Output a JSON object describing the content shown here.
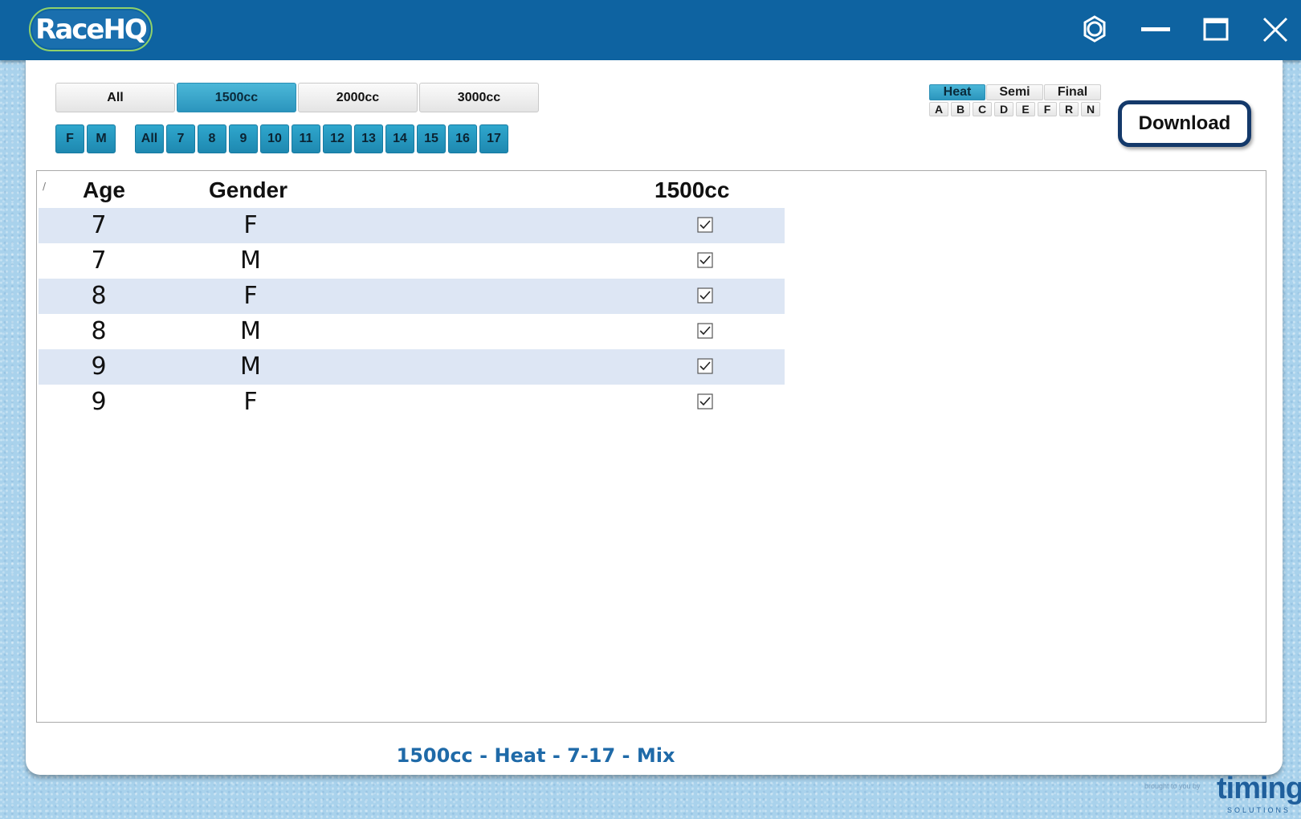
{
  "app": {
    "logo_text": "RaceHQ"
  },
  "window_controls": {
    "settings_icon": "gear-icon",
    "minimize_icon": "minimize-icon",
    "maximize_icon": "maximize-icon",
    "close_icon": "close-icon"
  },
  "class_tabs": [
    {
      "label": "All",
      "active": false
    },
    {
      "label": "1500cc",
      "active": true
    },
    {
      "label": "2000cc",
      "active": false
    },
    {
      "label": "3000cc",
      "active": false
    }
  ],
  "gender_filters": [
    "F",
    "M"
  ],
  "age_filters": [
    "All",
    "7",
    "8",
    "9",
    "10",
    "11",
    "12",
    "13",
    "14",
    "15",
    "16",
    "17"
  ],
  "round_tabs": [
    {
      "label": "Heat",
      "active": true
    },
    {
      "label": "Semi",
      "active": false
    },
    {
      "label": "Final",
      "active": false
    }
  ],
  "race_letters": [
    "A",
    "B",
    "C",
    "D",
    "E",
    "F",
    "R",
    "N"
  ],
  "download_label": "Download",
  "table": {
    "corner_mark": "/",
    "headers": {
      "age": "Age",
      "gender": "Gender",
      "class": "1500cc"
    },
    "rows": [
      {
        "age": "7",
        "gender": "F",
        "checked": true
      },
      {
        "age": "7",
        "gender": "M",
        "checked": true
      },
      {
        "age": "8",
        "gender": "F",
        "checked": true
      },
      {
        "age": "8",
        "gender": "M",
        "checked": true
      },
      {
        "age": "9",
        "gender": "M",
        "checked": true
      },
      {
        "age": "9",
        "gender": "F",
        "checked": true
      }
    ]
  },
  "status_text": "1500cc - Heat - 7-17 - Mix",
  "branding": {
    "tagline": "brought to you by",
    "name": "timing",
    "sub": "SOLUTIONS"
  },
  "colors": {
    "titlebar": "#0e63a1",
    "accent_teal": "#2b95bd",
    "row_shade": "#dde6f4",
    "status_text": "#1f6aa8"
  }
}
